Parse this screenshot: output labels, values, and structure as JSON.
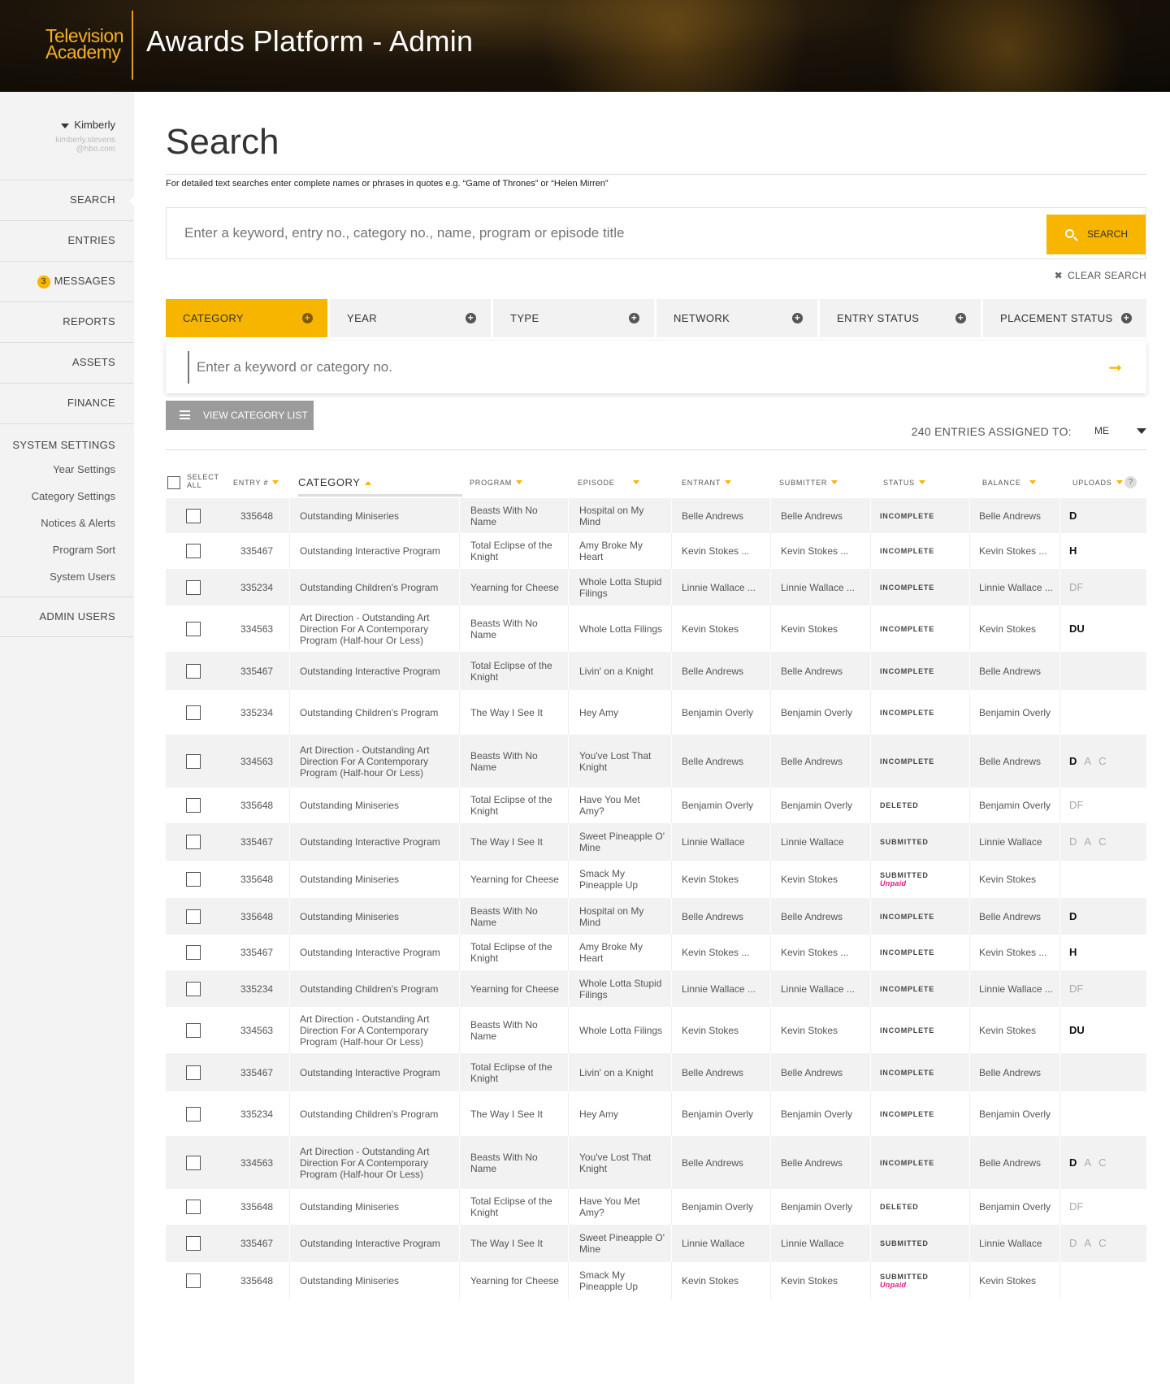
{
  "header": {
    "brand_line1": "Television",
    "brand_line2": "Academy",
    "title": "Awards Platform - Admin"
  },
  "sidebar": {
    "user_name": "Kimberly",
    "user_email_line1": "kimberly.stevens",
    "user_email_line2": "@hbo.com",
    "items": [
      {
        "label": "SEARCH",
        "active": true
      },
      {
        "label": "ENTRIES"
      },
      {
        "label": "MESSAGES",
        "badge": "3"
      },
      {
        "label": "REPORTS"
      },
      {
        "label": "ASSETS"
      },
      {
        "label": "FINANCE"
      }
    ],
    "system_settings": {
      "title": "SYSTEM SETTINGS",
      "subitems": [
        "Year Settings",
        "Category Settings",
        "Notices & Alerts",
        "Program Sort",
        "System Users"
      ]
    },
    "admin_users": "ADMIN USERS"
  },
  "main": {
    "page_title": "Search",
    "hint": "For detailed text searches enter complete names or phrases in quotes e.g. “Game of Thrones” or “Helen Mirren”",
    "search_placeholder": "Enter a keyword, entry no., category no., name, program or episode title",
    "search_button": "SEARCH",
    "clear_search": "CLEAR SEARCH",
    "filters": [
      "CATEGORY",
      "YEAR",
      "TYPE",
      "NETWORK",
      "ENTRY STATUS",
      "PLACEMENT STATUS"
    ],
    "keyword_placeholder": "Enter a keyword or category no.",
    "view_category_list": "VIEW CATEGORY LIST",
    "assigned_label": "240 ENTRIES ASSIGNED TO:",
    "assigned_value": "ME"
  },
  "table": {
    "headers": {
      "select_all_1": "SELECT",
      "select_all_2": "ALL",
      "entry": "ENTRY #",
      "category": "CATEGORY",
      "program": "PROGRAM",
      "episode": "EPISODE",
      "entrant": "ENTRANT",
      "submitter": "SUBMITTER",
      "status": "STATUS",
      "balance": "BALANCE",
      "uploads": "UPLOADS",
      "help": "?"
    },
    "rows": [
      {
        "entry": "335648",
        "category": "Outstanding Miniseries",
        "program": "Beasts With No Name",
        "episode": "Hospital on My Mind",
        "entrant": "Belle Andrews",
        "submitter": "Belle Andrews",
        "status": "INCOMPLETE",
        "unpaid": "",
        "balance": "Belle Andrews",
        "uploads": [
          {
            "t": "D",
            "on": true
          }
        ]
      },
      {
        "entry": "335467",
        "category": "Outstanding Interactive Program",
        "program": "Total Eclipse of the Knight",
        "episode": "Amy Broke My Heart",
        "entrant": "Kevin Stokes ...",
        "submitter": "Kevin Stokes ...",
        "status": "INCOMPLETE",
        "unpaid": "",
        "balance": "Kevin Stokes ...",
        "uploads": [
          {
            "t": "H",
            "on": true
          }
        ]
      },
      {
        "entry": "335234",
        "category": "Outstanding Children's Program",
        "program": "Yearning for Cheese",
        "episode": "Whole Lotta Stupid  Filings",
        "entrant": "Linnie Wallace ...",
        "submitter": "Linnie Wallace ...",
        "status": "INCOMPLETE",
        "unpaid": "",
        "balance": "Linnie Wallace ...",
        "uploads": [
          {
            "t": "DF",
            "on": false
          }
        ]
      },
      {
        "entry": "334563",
        "category": "Art Direction - Outstanding Art Direction For A Contemporary Program (Half-hour Or Less)",
        "program": "Beasts With No Name",
        "episode": "Whole Lotta Filings",
        "entrant": "Kevin Stokes",
        "submitter": "Kevin Stokes",
        "status": "INCOMPLETE",
        "unpaid": "",
        "balance": "Kevin Stokes",
        "uploads": [
          {
            "t": "DU",
            "on": true
          }
        ]
      },
      {
        "entry": "335467",
        "category": "Outstanding Interactive Program",
        "program": "Total Eclipse of the Knight",
        "episode": "Livin' on a Knight",
        "entrant": "Belle Andrews",
        "submitter": "Belle Andrews",
        "status": "INCOMPLETE",
        "unpaid": "",
        "balance": "Belle Andrews",
        "uploads": []
      },
      {
        "entry": "335234",
        "category": "Outstanding Children's Program",
        "program": "The Way I See It",
        "episode": "Hey Amy",
        "entrant": "Benjamin Overly",
        "submitter": "Benjamin Overly",
        "status": "INCOMPLETE",
        "unpaid": "",
        "balance": "Benjamin Overly",
        "uploads": []
      },
      {
        "entry": "334563",
        "category": "Art Direction - Outstanding Art Direction For A Contemporary Program (Half-hour Or Less)",
        "program": "Beasts With No Name",
        "episode": "You've Lost That Knight",
        "entrant": "Belle Andrews",
        "submitter": "Belle Andrews",
        "status": "INCOMPLETE",
        "unpaid": "",
        "balance": "Belle Andrews",
        "uploads": [
          {
            "t": "D",
            "on": true
          },
          {
            "t": "A",
            "on": false
          },
          {
            "t": "C",
            "on": false
          }
        ]
      },
      {
        "entry": "335648",
        "category": "Outstanding Miniseries",
        "program": "Total Eclipse of the Knight",
        "episode": "Have You Met Amy?",
        "entrant": "Benjamin Overly",
        "submitter": "Benjamin Overly",
        "status": "DELETED",
        "unpaid": "",
        "balance": "Benjamin Overly",
        "uploads": [
          {
            "t": "DF",
            "on": false
          }
        ]
      },
      {
        "entry": "335467",
        "category": "Outstanding Interactive Program",
        "program": "The Way I See It",
        "episode": "Sweet Pineapple O' Mine",
        "entrant": "Linnie Wallace",
        "submitter": "Linnie Wallace",
        "status": "SUBMITTED",
        "unpaid": "",
        "balance": "Linnie Wallace",
        "uploads": [
          {
            "t": "D",
            "on": false
          },
          {
            "t": "A",
            "on": false
          },
          {
            "t": "C",
            "on": false
          }
        ]
      },
      {
        "entry": "335648",
        "category": "Outstanding Miniseries",
        "program": "Yearning for Cheese",
        "episode": "Smack My Pineapple Up",
        "entrant": "Kevin Stokes",
        "submitter": "Kevin Stokes",
        "status": "SUBMITTED",
        "unpaid": "Unpaid",
        "balance": "Kevin Stokes",
        "uploads": []
      },
      {
        "entry": "335648",
        "category": "Outstanding Miniseries",
        "program": "Beasts With No Name",
        "episode": "Hospital on My Mind",
        "entrant": "Belle Andrews",
        "submitter": "Belle Andrews",
        "status": "INCOMPLETE",
        "unpaid": "",
        "balance": "Belle Andrews",
        "uploads": [
          {
            "t": "D",
            "on": true
          }
        ]
      },
      {
        "entry": "335467",
        "category": "Outstanding Interactive Program",
        "program": "Total Eclipse of the Knight",
        "episode": "Amy Broke My Heart",
        "entrant": "Kevin Stokes ...",
        "submitter": "Kevin Stokes ...",
        "status": "INCOMPLETE",
        "unpaid": "",
        "balance": "Kevin Stokes ...",
        "uploads": [
          {
            "t": "H",
            "on": true
          }
        ]
      },
      {
        "entry": "335234",
        "category": "Outstanding Children's Program",
        "program": "Yearning for Cheese",
        "episode": "Whole Lotta Stupid  Filings",
        "entrant": "Linnie Wallace ...",
        "submitter": "Linnie Wallace ...",
        "status": "INCOMPLETE",
        "unpaid": "",
        "balance": "Linnie Wallace ...",
        "uploads": [
          {
            "t": "DF",
            "on": false
          }
        ]
      },
      {
        "entry": "334563",
        "category": "Art Direction - Outstanding Art Direction For A Contemporary Program (Half-hour Or Less)",
        "program": "Beasts With No Name",
        "episode": "Whole Lotta Filings",
        "entrant": "Kevin Stokes",
        "submitter": "Kevin Stokes",
        "status": "INCOMPLETE",
        "unpaid": "",
        "balance": "Kevin Stokes",
        "uploads": [
          {
            "t": "DU",
            "on": true
          }
        ]
      },
      {
        "entry": "335467",
        "category": "Outstanding Interactive Program",
        "program": "Total Eclipse of the Knight",
        "episode": "Livin' on a Knight",
        "entrant": "Belle Andrews",
        "submitter": "Belle Andrews",
        "status": "INCOMPLETE",
        "unpaid": "",
        "balance": "Belle Andrews",
        "uploads": []
      },
      {
        "entry": "335234",
        "category": "Outstanding Children's Program",
        "program": "The Way I See It",
        "episode": "Hey Amy",
        "entrant": "Benjamin Overly",
        "submitter": "Benjamin Overly",
        "status": "INCOMPLETE",
        "unpaid": "",
        "balance": "Benjamin Overly",
        "uploads": []
      },
      {
        "entry": "334563",
        "category": "Art Direction - Outstanding Art Direction For A Contemporary Program (Half-hour Or Less)",
        "program": "Beasts With No Name",
        "episode": "You've Lost That Knight",
        "entrant": "Belle Andrews",
        "submitter": "Belle Andrews",
        "status": "INCOMPLETE",
        "unpaid": "",
        "balance": "Belle Andrews",
        "uploads": [
          {
            "t": "D",
            "on": true
          },
          {
            "t": "A",
            "on": false
          },
          {
            "t": "C",
            "on": false
          }
        ]
      },
      {
        "entry": "335648",
        "category": "Outstanding Miniseries",
        "program": "Total Eclipse of the Knight",
        "episode": "Have You Met Amy?",
        "entrant": "Benjamin Overly",
        "submitter": "Benjamin Overly",
        "status": "DELETED",
        "unpaid": "",
        "balance": "Benjamin Overly",
        "uploads": [
          {
            "t": "DF",
            "on": false
          }
        ]
      },
      {
        "entry": "335467",
        "category": "Outstanding Interactive Program",
        "program": "The Way I See It",
        "episode": "Sweet Pineapple O' Mine",
        "entrant": "Linnie Wallace",
        "submitter": "Linnie Wallace",
        "status": "SUBMITTED",
        "unpaid": "",
        "balance": "Linnie Wallace",
        "uploads": [
          {
            "t": "D",
            "on": false
          },
          {
            "t": "A",
            "on": false
          },
          {
            "t": "C",
            "on": false
          }
        ]
      },
      {
        "entry": "335648",
        "category": "Outstanding Miniseries",
        "program": "Yearning for Cheese",
        "episode": "Smack My Pineapple Up",
        "entrant": "Kevin Stokes",
        "submitter": "Kevin Stokes",
        "status": "SUBMITTED",
        "unpaid": "Unpaid",
        "balance": "Kevin Stokes",
        "uploads": []
      }
    ]
  },
  "colors": {
    "accent": "#f7b500",
    "unpaid": "#e2137f",
    "brand": "#f5b021"
  }
}
